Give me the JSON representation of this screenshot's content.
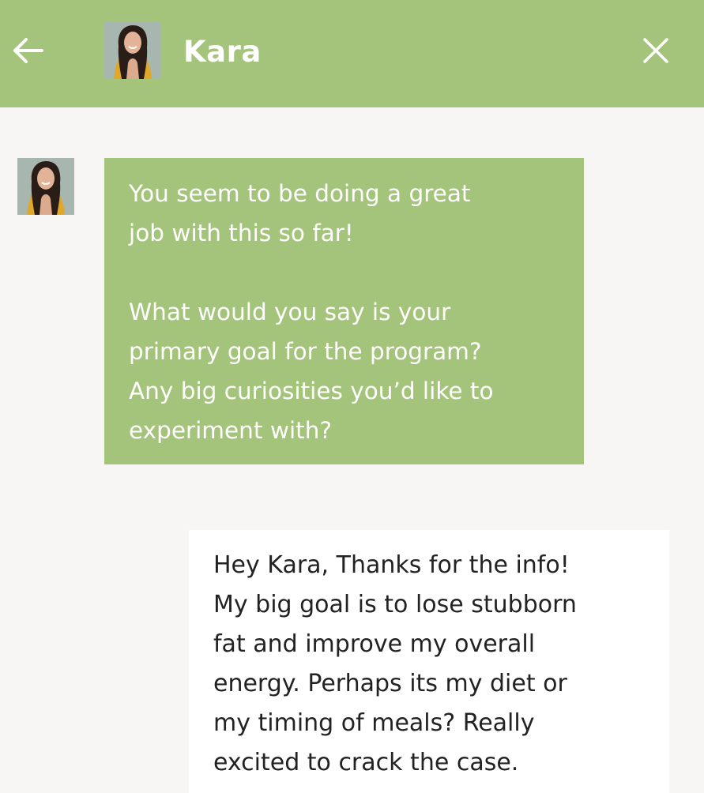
{
  "header": {
    "back_icon": "arrow-left-icon",
    "close_icon": "close-icon",
    "contact_name": "Kara",
    "background_color": "#a5c47b"
  },
  "messages": [
    {
      "sender": "Kara",
      "direction": "incoming",
      "paragraph_1": "You seem to be doing a great\njob with this so far!",
      "paragraph_2": "What would you say is your\nprimary goal for the program?\nAny big curiosities you’d like to\nexperiment with?"
    },
    {
      "direction": "outgoing",
      "text": "Hey Kara, Thanks for the info!\nMy big goal is to lose stubborn\nfat and improve my overall\nenergy. Perhaps its my diet or\nmy timing of meals? Really\nexcited to crack the case."
    }
  ]
}
